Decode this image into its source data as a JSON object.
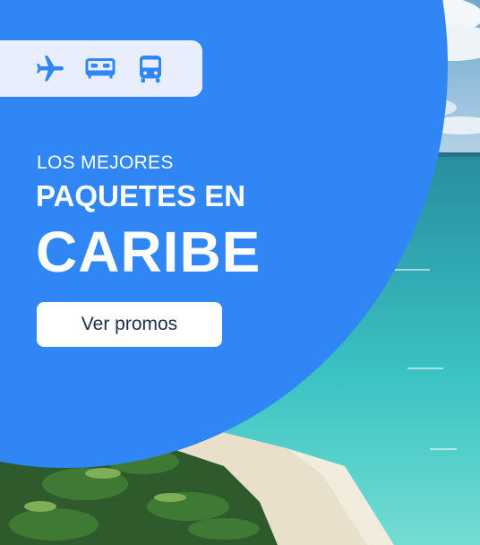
{
  "promo": {
    "kicker": "LOS MEJORES",
    "headline": "PAQUETES EN",
    "destination": "CARIBE",
    "cta_label": "Ver promos"
  },
  "product_icons": [
    "airplane-icon",
    "bed-icon",
    "bus-icon"
  ],
  "colors": {
    "panel_blue": "#2f86f4",
    "tab_background": "#e8eefb",
    "icon_blue": "#2f86f4",
    "cta_text": "#1c2c4a"
  }
}
